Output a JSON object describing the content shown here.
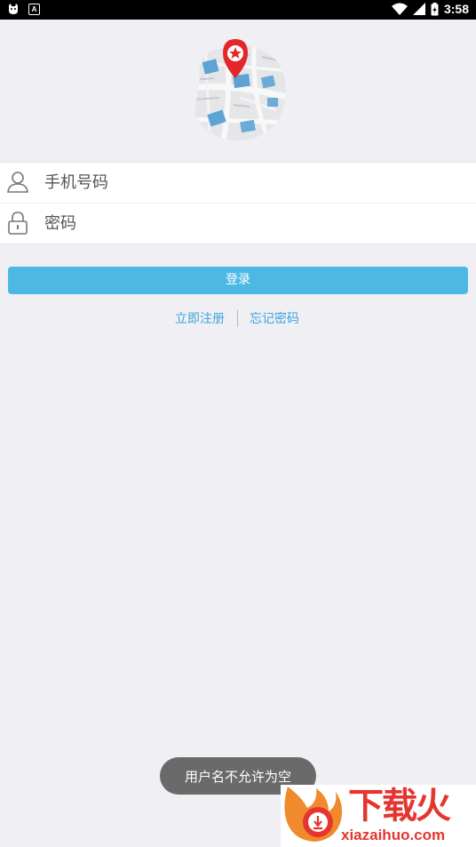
{
  "status_bar": {
    "time": "3:58",
    "left_icons": [
      "cat-icon",
      "a-icon"
    ],
    "right_icons": [
      "wifi-icon",
      "signal-icon",
      "battery-icon"
    ]
  },
  "app": {
    "logo": "map-pin-logo"
  },
  "form": {
    "phone_placeholder": "手机号码",
    "password_placeholder": "密码"
  },
  "actions": {
    "login_label": "登录",
    "register_label": "立即注册",
    "forgot_label": "忘记密码"
  },
  "toast": {
    "message": "用户名不允许为空"
  },
  "watermark": {
    "brand": "下载火",
    "domain": "xiazaihuo.com"
  },
  "colors": {
    "background": "#efeff4",
    "primary": "#4eb8e4",
    "link": "#3aa6df",
    "watermark": "#e5352f"
  }
}
